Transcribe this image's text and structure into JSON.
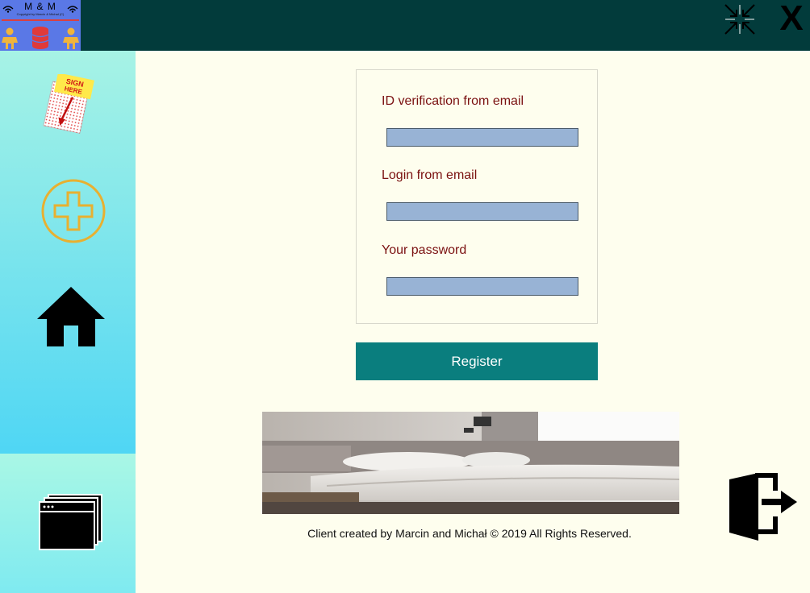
{
  "app": {
    "logo_title": "M & M",
    "logo_subtitle": "Copyright by Marcin & Michał (C)"
  },
  "window": {
    "minimize_icon": "shrink-arrows-icon",
    "close_label": "X"
  },
  "sidebar": {
    "items": [
      {
        "icon": "sign-here-icon",
        "badge_text": "SIGN HERE"
      },
      {
        "icon": "add-circle-icon"
      },
      {
        "icon": "home-icon"
      },
      {
        "icon": "windows-stack-icon"
      }
    ]
  },
  "form": {
    "fields": [
      {
        "label": "ID verification from email",
        "value": "",
        "placeholder": ""
      },
      {
        "label": "Login from email",
        "value": "",
        "placeholder": ""
      },
      {
        "label": "Your password",
        "value": "",
        "placeholder": ""
      }
    ],
    "register_label": "Register"
  },
  "footer": {
    "text": "Client created by Marcin and Michał  © 2019  All Rights Reserved."
  },
  "colors": {
    "titlebar": "#023b3b",
    "accent_button": "#0a7e7e",
    "field_fill": "#98b3d5",
    "label_text": "#7a1010",
    "background": "#fefeee"
  }
}
